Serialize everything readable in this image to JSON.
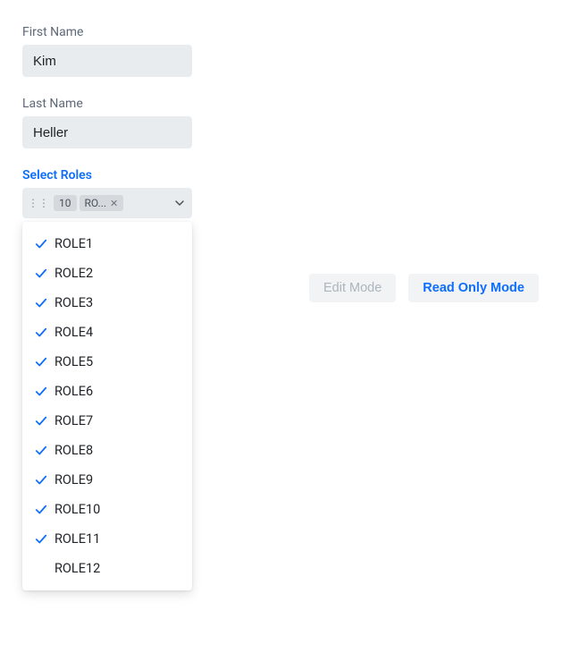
{
  "form": {
    "firstName": {
      "label": "First Name",
      "value": "Kim"
    },
    "lastName": {
      "label": "Last Name",
      "value": "Heller"
    },
    "roles": {
      "label": "Select Roles",
      "count": "10",
      "tagText": "RO...",
      "options": [
        {
          "label": "ROLE1",
          "selected": true
        },
        {
          "label": "ROLE2",
          "selected": true
        },
        {
          "label": "ROLE3",
          "selected": true
        },
        {
          "label": "ROLE4",
          "selected": true
        },
        {
          "label": "ROLE5",
          "selected": true
        },
        {
          "label": "ROLE6",
          "selected": true
        },
        {
          "label": "ROLE7",
          "selected": true
        },
        {
          "label": "ROLE8",
          "selected": true
        },
        {
          "label": "ROLE9",
          "selected": true
        },
        {
          "label": "ROLE10",
          "selected": true
        },
        {
          "label": "ROLE11",
          "selected": true
        },
        {
          "label": "ROLE12",
          "selected": false
        }
      ]
    }
  },
  "buttons": {
    "editMode": "Edit Mode",
    "readOnlyMode": "Read Only Mode"
  },
  "colors": {
    "primary": "#0d6efd",
    "inputBg": "#e9ecef",
    "tagBg": "#d5d9dd"
  }
}
